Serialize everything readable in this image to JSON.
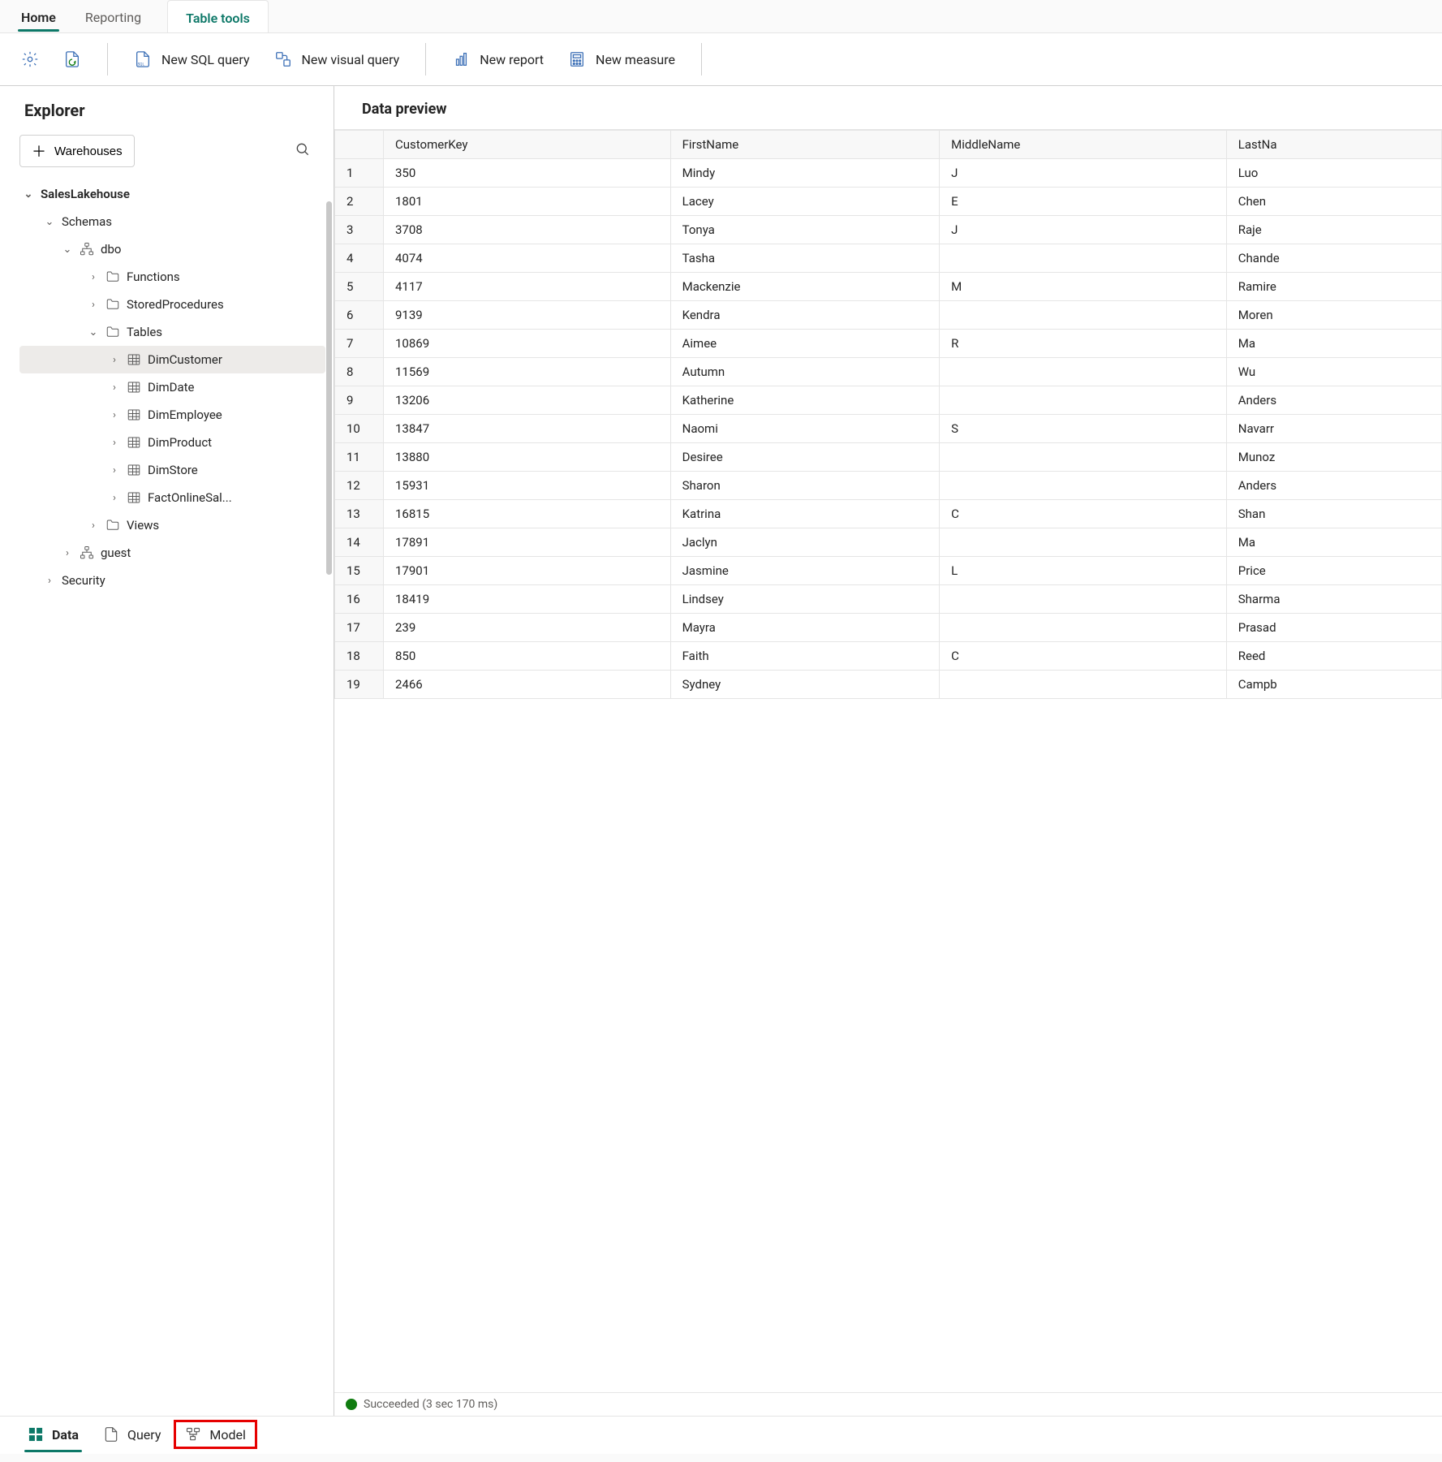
{
  "ribbon": {
    "tabs": [
      "Home",
      "Reporting",
      "Table tools"
    ]
  },
  "toolbar": {
    "new_sql": "New SQL query",
    "new_visual": "New visual query",
    "new_report": "New report",
    "new_measure": "New measure"
  },
  "explorer": {
    "title": "Explorer",
    "warehouses_btn": "Warehouses",
    "root": "SalesLakehouse",
    "schemas_label": "Schemas",
    "dbo_label": "dbo",
    "functions_label": "Functions",
    "sprocs_label": "StoredProcedures",
    "tables_label": "Tables",
    "tables": [
      "DimCustomer",
      "DimDate",
      "DimEmployee",
      "DimProduct",
      "DimStore",
      "FactOnlineSal..."
    ],
    "views_label": "Views",
    "guest_label": "guest",
    "security_label": "Security",
    "selected_table_index": 0
  },
  "preview": {
    "title": "Data preview",
    "columns": [
      "CustomerKey",
      "FirstName",
      "MiddleName",
      "LastNa"
    ],
    "rows": [
      [
        "350",
        "Mindy",
        "J",
        "Luo"
      ],
      [
        "1801",
        "Lacey",
        "E",
        "Chen"
      ],
      [
        "3708",
        "Tonya",
        "J",
        "Raje"
      ],
      [
        "4074",
        "Tasha",
        "",
        "Chande"
      ],
      [
        "4117",
        "Mackenzie",
        "M",
        "Ramire"
      ],
      [
        "9139",
        "Kendra",
        "",
        "Moren"
      ],
      [
        "10869",
        "Aimee",
        "R",
        "Ma"
      ],
      [
        "11569",
        "Autumn",
        "",
        "Wu"
      ],
      [
        "13206",
        "Katherine",
        "",
        "Anders"
      ],
      [
        "13847",
        "Naomi",
        "S",
        "Navarr"
      ],
      [
        "13880",
        "Desiree",
        "",
        "Munoz"
      ],
      [
        "15931",
        "Sharon",
        "",
        "Anders"
      ],
      [
        "16815",
        "Katrina",
        "C",
        "Shan"
      ],
      [
        "17891",
        "Jaclyn",
        "",
        "Ma"
      ],
      [
        "17901",
        "Jasmine",
        "L",
        "Price"
      ],
      [
        "18419",
        "Lindsey",
        "",
        "Sharma"
      ],
      [
        "239",
        "Mayra",
        "",
        "Prasad"
      ],
      [
        "850",
        "Faith",
        "C",
        "Reed"
      ],
      [
        "2466",
        "Sydney",
        "",
        "Campb"
      ]
    ],
    "status_prefix": "Succeeded",
    "status_time": "(3 sec 170 ms)"
  },
  "bottom_tabs": {
    "data": "Data",
    "query": "Query",
    "model": "Model"
  }
}
